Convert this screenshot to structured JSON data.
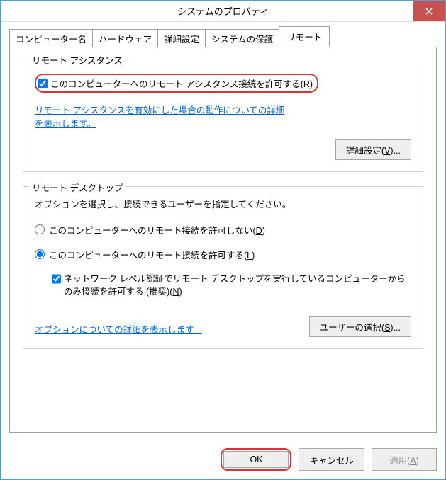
{
  "window": {
    "title": "システムのプロパティ"
  },
  "tabs": {
    "t0": "コンピューター名",
    "t1": "ハードウェア",
    "t2": "詳細設定",
    "t3": "システムの保護",
    "t4": "リモート"
  },
  "remoteAssistance": {
    "groupLabel": "リモート アシスタンス",
    "allowLabel": "このコンピューターへのリモート アシスタンス接続を許可する(",
    "allowKey": "R",
    "allowLabelEnd": ")",
    "helpLink": "リモート アシスタンスを有効にした場合の動作についての詳細を表示します。",
    "advancedBtn": "詳細設定(",
    "advancedKey": "V",
    "advancedBtnEnd": ")..."
  },
  "remoteDesktop": {
    "groupLabel": "リモート デスクトップ",
    "desc": "オプションを選択し、接続できるユーザーを指定してください。",
    "radioDisallow": "このコンピューターへのリモート接続を許可しない(",
    "radioDisallowKey": "D",
    "radioDisallowEnd": ")",
    "radioAllow": "このコンピューターへのリモート接続を許可する(",
    "radioAllowKey": "L",
    "radioAllowEnd": ")",
    "nlaLabel": "ネットワーク レベル認証でリモート デスクトップを実行しているコンピューターからのみ接続を許可する (推奨)(",
    "nlaKey": "N",
    "nlaEnd": ")",
    "optionsLink": "オプションについての詳細を表示します。",
    "selectUsersBtn": "ユーザーの選択(",
    "selectUsersKey": "S",
    "selectUsersBtnEnd": ")..."
  },
  "footer": {
    "ok": "OK",
    "cancel": "キャンセル",
    "apply": "適用(",
    "applyKey": "A",
    "applyEnd": ")"
  }
}
